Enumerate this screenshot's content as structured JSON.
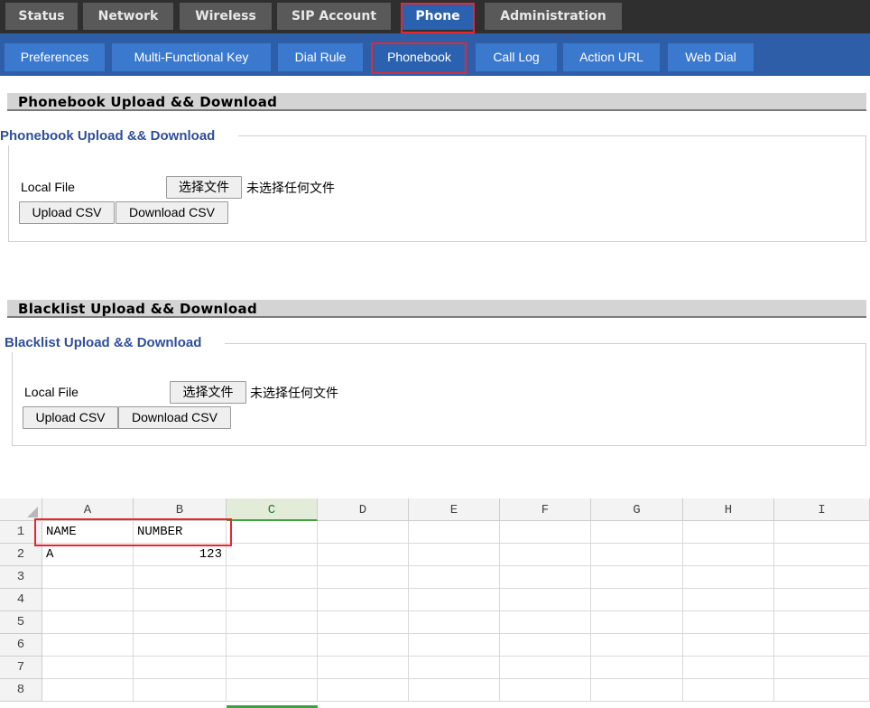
{
  "top_nav": [
    {
      "label": "Status",
      "active": false
    },
    {
      "label": "Network",
      "active": false
    },
    {
      "label": "Wireless",
      "active": false
    },
    {
      "label": "SIP Account",
      "active": false
    },
    {
      "label": "Phone",
      "active": true
    },
    {
      "label": "Administration",
      "active": false
    }
  ],
  "sub_nav": [
    {
      "label": "Preferences",
      "active": false
    },
    {
      "label": "Multi-Functional Key",
      "active": false
    },
    {
      "label": "Dial Rule",
      "active": false
    },
    {
      "label": "Phonebook",
      "active": true
    },
    {
      "label": "Call Log",
      "active": false
    },
    {
      "label": "Action URL",
      "active": false
    },
    {
      "label": "Web Dial",
      "active": false
    }
  ],
  "phonebook": {
    "header": "Phonebook Upload && Download",
    "legend": "Phonebook Upload && Download",
    "local_file_label": "Local File",
    "choose_file_label": "选择文件",
    "no_file_text": "未选择任何文件",
    "upload_label": "Upload CSV",
    "download_label": "Download CSV"
  },
  "blacklist": {
    "header": "Blacklist Upload && Download",
    "legend": "Blacklist Upload && Download",
    "local_file_label": "Local File",
    "choose_file_label": "选择文件",
    "no_file_text": "未选择任何文件",
    "upload_label": "Upload CSV",
    "download_label": "Download CSV"
  },
  "spreadsheet": {
    "columns": [
      "A",
      "B",
      "C",
      "D",
      "E",
      "F",
      "G",
      "H",
      "I"
    ],
    "selected_column": "C",
    "rows": [
      "1",
      "2",
      "3",
      "4",
      "5",
      "6",
      "7",
      "8"
    ],
    "cells": {
      "row1": [
        "NAME",
        "NUMBER"
      ],
      "row2": [
        "A",
        "123"
      ]
    }
  },
  "colors": {
    "top_bar": "#2f2f2f",
    "top_tab": "#595959",
    "active_tab": "#2a62b0",
    "sub_bar": "#2e5ea8",
    "sub_tab": "#3b79cf",
    "highlight_box": "#e8262e",
    "legend_text": "#2f4f9a",
    "selected_column": "#3fa142"
  }
}
